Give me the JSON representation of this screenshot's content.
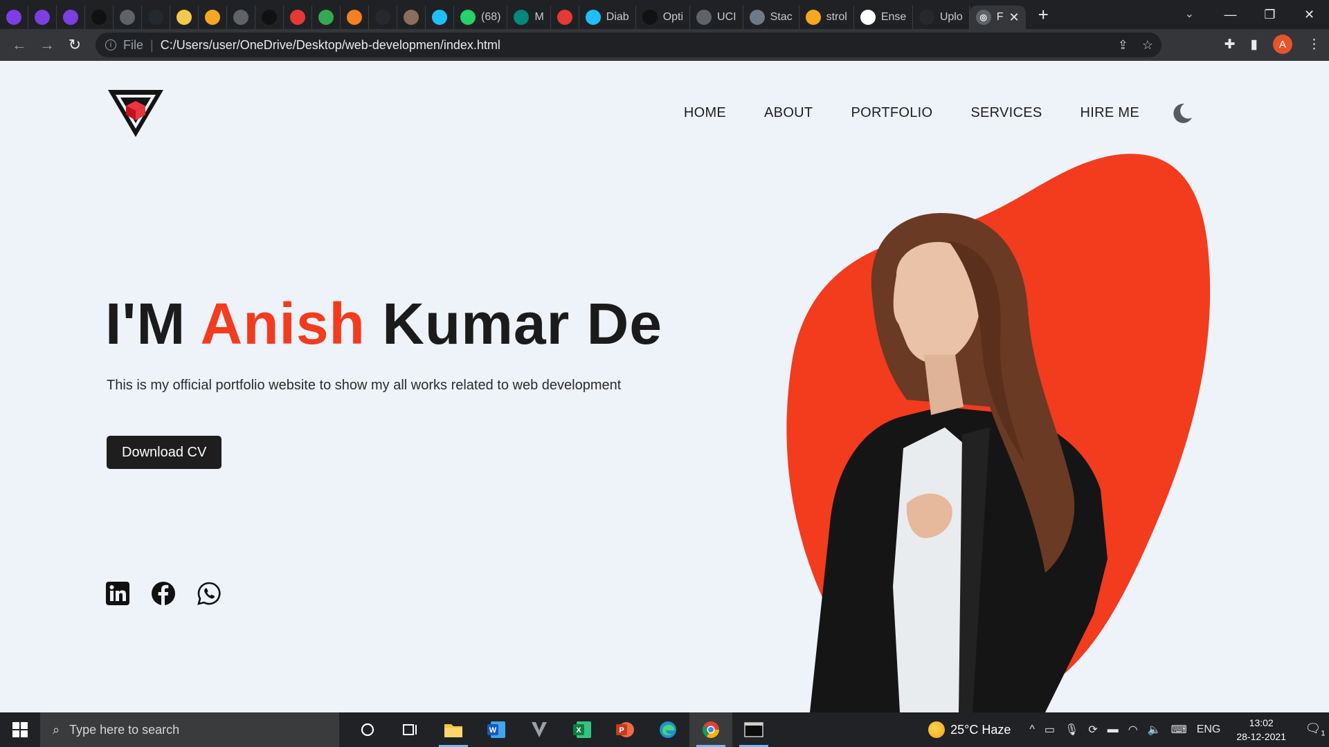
{
  "browser": {
    "tabs": [
      {
        "icon": "u-purple-icon",
        "label": "",
        "color": "#7b3fe4"
      },
      {
        "icon": "u-purple-icon",
        "label": "",
        "color": "#7b3fe4"
      },
      {
        "icon": "u-purple-icon",
        "label": "",
        "color": "#7b3fe4"
      },
      {
        "icon": "hackerrank-icon",
        "label": "",
        "color": "#111111"
      },
      {
        "icon": "globe-icon",
        "label": "",
        "color": "#5f6368"
      },
      {
        "icon": "github-icon",
        "label": "",
        "color": "#24292f"
      },
      {
        "icon": "bitcoin-icon",
        "label": "",
        "color": "#f2c94c"
      },
      {
        "icon": "firebase-icon",
        "label": "",
        "color": "#f5a623"
      },
      {
        "icon": "graduation-cap-icon",
        "label": "",
        "color": "#5f6368"
      },
      {
        "icon": "a-circle-icon",
        "label": "",
        "color": "#111111"
      },
      {
        "icon": "gear-red-icon",
        "label": "",
        "color": "#e53935"
      },
      {
        "icon": "google-drive-icon",
        "label": "",
        "color": "#34a853"
      },
      {
        "icon": "stack-overflow-icon",
        "label": "",
        "color": "#f48024"
      },
      {
        "icon": "github-icon",
        "label": "",
        "color": "#24292f"
      },
      {
        "icon": "cc-icon",
        "label": "",
        "color": "#8a6d5a"
      },
      {
        "icon": "kaggle-icon",
        "label": "",
        "color": "#20beff"
      },
      {
        "icon": "whatsapp-icon",
        "label": "(68)",
        "color": "#25d366"
      },
      {
        "icon": "meet-icon",
        "label": "M",
        "color": "#00897b"
      },
      {
        "icon": "record-icon",
        "label": "",
        "color": "#e53935"
      },
      {
        "icon": "kaggle-icon",
        "label": "Diab",
        "color": "#20beff"
      },
      {
        "icon": "medium-icon",
        "label": "Opti",
        "color": "#111111"
      },
      {
        "icon": "globe-icon",
        "label": "UCI",
        "color": "#5f6368"
      },
      {
        "icon": "image-icon",
        "label": "Stac",
        "color": "#6c7a89"
      },
      {
        "icon": "infinity-icon",
        "label": "strol",
        "color": "#f5a623"
      },
      {
        "icon": "chart-icon",
        "label": "Ense",
        "color": "#ffffff"
      },
      {
        "icon": "github-icon",
        "label": "Uplo",
        "color": "#24292f"
      }
    ],
    "active_tab": {
      "icon": "globe-icon",
      "label": "F"
    },
    "new_tab": "+",
    "url_scheme": "File",
    "url": "C:/Users/user/OneDrive/Desktop/web-developmen/index.html",
    "profile_initial": "A"
  },
  "site": {
    "nav": [
      "HOME",
      "ABOUT",
      "PORTFOLIO",
      "SERVICES",
      "HIRE ME"
    ],
    "hero": {
      "prefix": "I'M",
      "accent_name": "Anish",
      "rest_name": "Kumar De",
      "subtitle": "This is my official portfolio website to show my all works related to web development",
      "button": "Download CV"
    },
    "socials": [
      "linkedin-icon",
      "facebook-icon",
      "whatsapp-icon"
    ],
    "accent_color": "#f33b1e",
    "dark_color": "#1e1e1e"
  },
  "taskbar": {
    "search_placeholder": "Type here to search",
    "weather": "25°C  Haze",
    "language": "ENG",
    "time": "13:02",
    "date": "28-12-2021",
    "notification_count": "1"
  }
}
